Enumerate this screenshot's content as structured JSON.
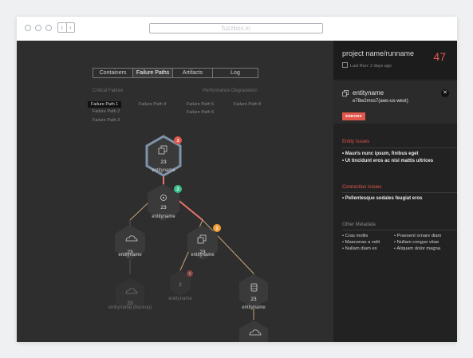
{
  "browser": {
    "url": "fuzzbox.io",
    "back": "‹",
    "forward": "›"
  },
  "tabs": [
    {
      "label": "Containers",
      "active": false
    },
    {
      "label": "Failure Paths",
      "active": true
    },
    {
      "label": "Artifacts",
      "active": false
    },
    {
      "label": "Log",
      "active": false
    }
  ],
  "sections": {
    "critical": "Critical Failure",
    "performance": "Performance Degradation"
  },
  "failure_paths": [
    "Failure Path 1",
    "Failure Path 2",
    "Failure Path 3",
    "Failure Path 4",
    "Failure Path 5",
    "Failure Path 6",
    "Failure Path 8"
  ],
  "nodes": [
    {
      "value": "23",
      "label": "entityname",
      "badge": "3"
    },
    {
      "value": "23",
      "label": "entityname",
      "badge": "2"
    },
    {
      "value": "23",
      "label": "entityname"
    },
    {
      "value": "23",
      "label": "entityname",
      "badge": "1"
    },
    {
      "value": "23",
      "label": "entityname (backup)"
    },
    {
      "value": "2",
      "label": "entityname",
      "badge": "5"
    },
    {
      "value": "23",
      "label": "entityname"
    },
    {
      "value": "23",
      "label": "entityname"
    }
  ],
  "sidebar": {
    "project": "project name/runname",
    "last_run": "Last Run: 2 days ago",
    "count": "47",
    "entity": {
      "name": "entityname",
      "id": "e78w2mns7(aws-us-west)",
      "close": "✕",
      "badge": "ERRORS"
    },
    "entity_issues_title": "Entity Issues",
    "entity_issues": [
      "• Mauris nunc ipsum, finibus eget",
      "• Ut tincidunt eros ac nisl mattis ultrices"
    ],
    "connection_issues_title": "Connection Issues",
    "connection_issues": [
      "• Pellentesque sodales feugiat eros"
    ],
    "metadata_title": "Other Metadata",
    "metadata_left": [
      "• Cras mollis",
      "• Maecenas a velit",
      "• Nullam diam ex"
    ],
    "metadata_right": [
      "• Praesent ornare diam",
      "• Nullam congue vitae",
      "• Aliquam dolor magna"
    ]
  },
  "colors": {
    "accent": "#e2574c",
    "badge_red": "#e2574c",
    "badge_green": "#3cc08a",
    "badge_orange": "#f0a03a",
    "node": "#3a3a3a",
    "selected_node": "#7d94aa"
  }
}
